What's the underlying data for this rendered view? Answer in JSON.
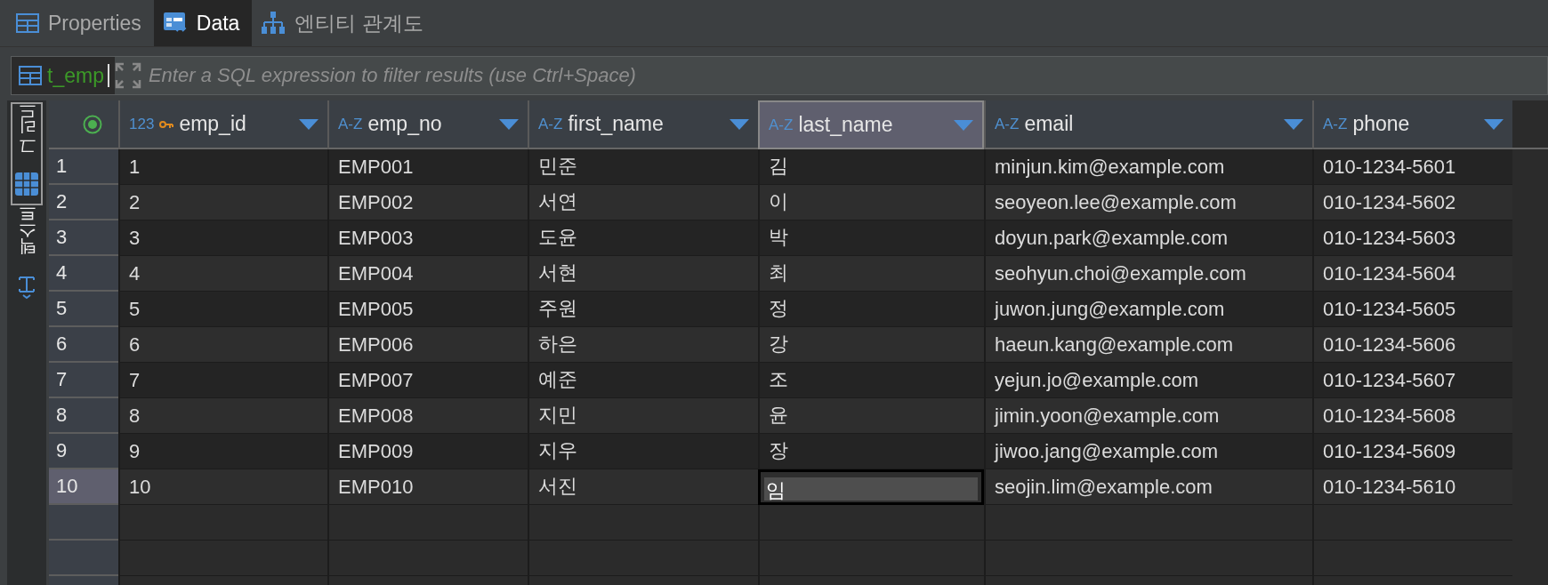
{
  "tabs": [
    {
      "label": "Properties",
      "selected": false
    },
    {
      "label": "Data",
      "selected": true
    },
    {
      "label": "엔티티 관계도",
      "selected": false
    }
  ],
  "filter": {
    "table_name": "t_emp",
    "placeholder": "Enter a SQL expression to filter results (use Ctrl+Space)"
  },
  "side_tabs": [
    {
      "label": "그리드",
      "selected": true
    },
    {
      "label": "텍스트",
      "selected": false
    }
  ],
  "columns": [
    {
      "type": "123",
      "key": true,
      "name": "emp_id",
      "selected": false
    },
    {
      "type": "A-Z",
      "key": false,
      "name": "emp_no",
      "selected": false
    },
    {
      "type": "A-Z",
      "key": false,
      "name": "first_name",
      "selected": false
    },
    {
      "type": "A-Z",
      "key": false,
      "name": "last_name",
      "selected": true
    },
    {
      "type": "A-Z",
      "key": false,
      "name": "email",
      "selected": false
    },
    {
      "type": "A-Z",
      "key": false,
      "name": "phone",
      "selected": false
    }
  ],
  "rows": [
    {
      "number": "1",
      "selected": false,
      "cells": [
        "1",
        "EMP001",
        "민준",
        "김",
        "minjun.kim@example.com",
        "010-1234-5601"
      ]
    },
    {
      "number": "2",
      "selected": false,
      "cells": [
        "2",
        "EMP002",
        "서연",
        "이",
        "seoyeon.lee@example.com",
        "010-1234-5602"
      ]
    },
    {
      "number": "3",
      "selected": false,
      "cells": [
        "3",
        "EMP003",
        "도윤",
        "박",
        "doyun.park@example.com",
        "010-1234-5603"
      ]
    },
    {
      "number": "4",
      "selected": false,
      "cells": [
        "4",
        "EMP004",
        "서현",
        "최",
        "seohyun.choi@example.com",
        "010-1234-5604"
      ]
    },
    {
      "number": "5",
      "selected": false,
      "cells": [
        "5",
        "EMP005",
        "주원",
        "정",
        "juwon.jung@example.com",
        "010-1234-5605"
      ]
    },
    {
      "number": "6",
      "selected": false,
      "cells": [
        "6",
        "EMP006",
        "하은",
        "강",
        "haeun.kang@example.com",
        "010-1234-5606"
      ]
    },
    {
      "number": "7",
      "selected": false,
      "cells": [
        "7",
        "EMP007",
        "예준",
        "조",
        "yejun.jo@example.com",
        "010-1234-5607"
      ]
    },
    {
      "number": "8",
      "selected": false,
      "cells": [
        "8",
        "EMP008",
        "지민",
        "윤",
        "jimin.yoon@example.com",
        "010-1234-5608"
      ]
    },
    {
      "number": "9",
      "selected": false,
      "cells": [
        "9",
        "EMP009",
        "지우",
        "장",
        "jiwoo.jang@example.com",
        "010-1234-5609"
      ]
    },
    {
      "number": "10",
      "selected": true,
      "cells": [
        "10",
        "EMP010",
        "서진",
        "임",
        "seojin.lim@example.com",
        "010-1234-5610"
      ]
    }
  ]
}
